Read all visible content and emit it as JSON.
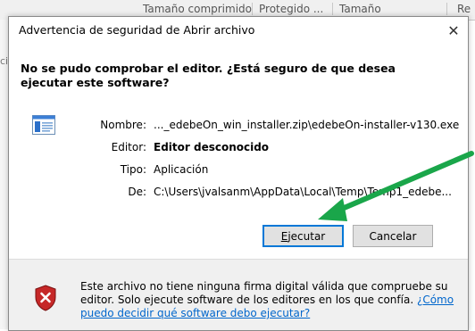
{
  "background": {
    "columns": [
      "Tamaño comprimido",
      "Protegido ...",
      "Tamaño",
      "Re"
    ],
    "left_fragment": "ci"
  },
  "dialog": {
    "title": "Advertencia de seguridad de Abrir archivo",
    "close_glyph": "✕",
    "question": "No se pudo comprobar el editor. ¿Está seguro de que desea ejecutar este software?",
    "fields": [
      {
        "label": "Nombre:",
        "value": "..._edebeOn_win_installer.zip\\edebeOn-installer-v130.exe",
        "bold": false
      },
      {
        "label": "Editor:",
        "value": "Editor desconocido",
        "bold": true
      },
      {
        "label": "Tipo:",
        "value": "Aplicación",
        "bold": false
      },
      {
        "label": "De:",
        "value": "C:\\Users\\jvalsanm\\AppData\\Local\\Temp\\Temp1_edebe...",
        "bold": false
      }
    ],
    "buttons": {
      "run": {
        "label_prefix": "",
        "label_underlined": "E",
        "label_rest": "jecutar"
      },
      "cancel": {
        "label": "Cancelar"
      }
    },
    "warning": {
      "text": "Este archivo no tiene ninguna firma digital válida que compruebe su editor. Solo ejecute software de los editores en los que confía. ",
      "link": "¿Cómo puedo decidir qué software debo ejecutar?"
    }
  },
  "colors": {
    "annotation_arrow": "#1aa64a",
    "link": "#0066cc",
    "focus_border": "#0078d7",
    "shield_red": "#c62828"
  },
  "icons": {
    "file": "executable-file-icon",
    "shield": "security-shield-icon",
    "close": "close-icon"
  }
}
